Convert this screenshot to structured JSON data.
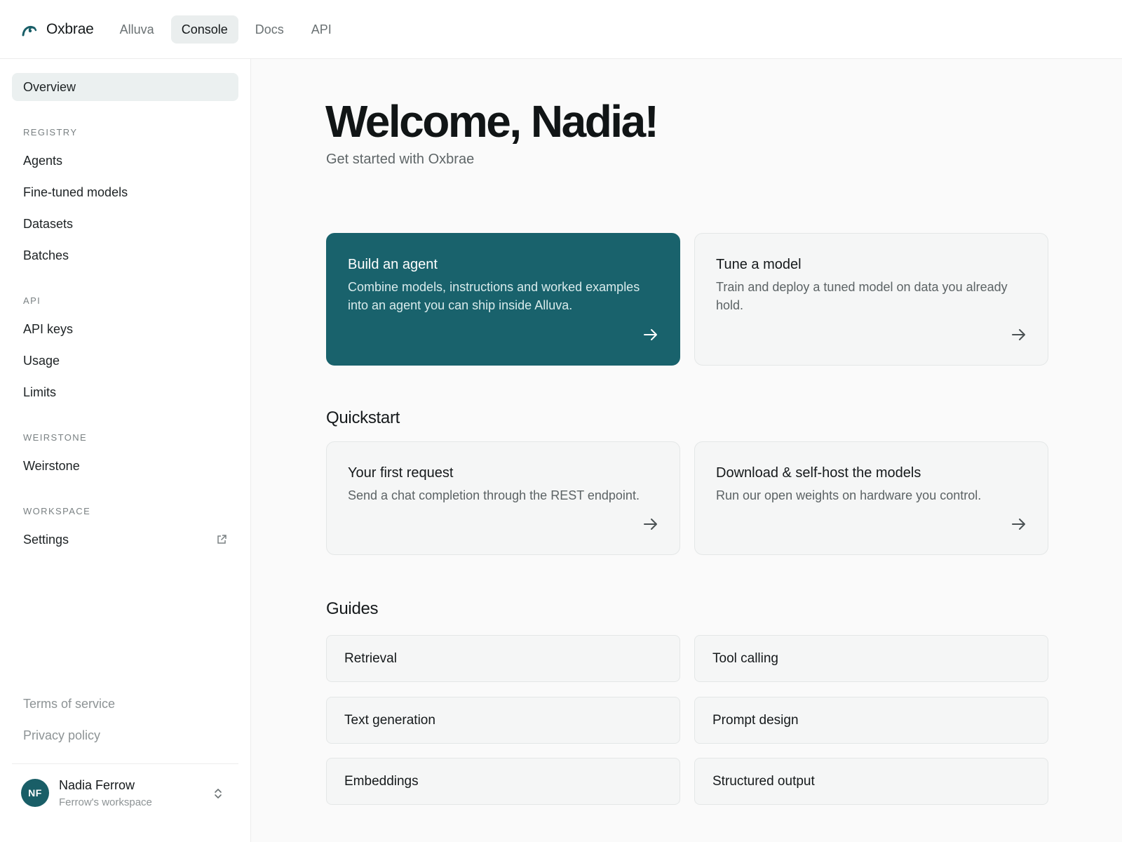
{
  "brand": {
    "name": "Oxbrae",
    "icon": "oxbrae-logo-icon",
    "color": "#195e67"
  },
  "topnav": {
    "tabs": [
      {
        "label": "Alluva",
        "active": false
      },
      {
        "label": "Console",
        "active": true
      },
      {
        "label": "Docs",
        "active": false
      },
      {
        "label": "API",
        "active": false
      }
    ]
  },
  "sidebar": {
    "overview": "Overview",
    "sections": [
      {
        "title": "REGISTRY",
        "items": [
          "Agents",
          "Fine-tuned models",
          "Datasets",
          "Batches"
        ]
      },
      {
        "title": "API",
        "items": [
          "API keys",
          "Usage",
          "Limits"
        ]
      },
      {
        "title": "WEIRSTONE",
        "items": [
          "Weirstone"
        ]
      },
      {
        "title": "WORKSPACE",
        "items": [
          "Settings"
        ]
      }
    ],
    "footer_links": [
      "Terms of service",
      "Privacy policy"
    ],
    "account": {
      "initials": "NF",
      "name": "Nadia Ferrow",
      "workspace": "Ferrow's workspace"
    }
  },
  "main": {
    "title": "Welcome, Nadia!",
    "subtitle": "Get started with Oxbrae",
    "hero_cards": [
      {
        "title": "Build an agent",
        "desc": "Combine models, instructions and worked examples into an agent you can ship inside Alluva.",
        "primary": true
      },
      {
        "title": "Tune a model",
        "desc": "Train and deploy a tuned model on data you already hold.",
        "primary": false
      }
    ],
    "quickstart": {
      "title": "Quickstart",
      "cards": [
        {
          "title": "Your first request",
          "desc": "Send a chat completion through the REST endpoint."
        },
        {
          "title": "Download & self-host the models",
          "desc": "Run our open weights on hardware you control."
        }
      ]
    },
    "guides": {
      "title": "Guides",
      "items": [
        "Retrieval",
        "Tool calling",
        "Text generation",
        "Prompt design",
        "Embeddings",
        "Structured output"
      ]
    }
  },
  "colors": {
    "accent": "#19626c",
    "active_bg": "#ebf0f0",
    "muted_text": "#8d9395"
  }
}
